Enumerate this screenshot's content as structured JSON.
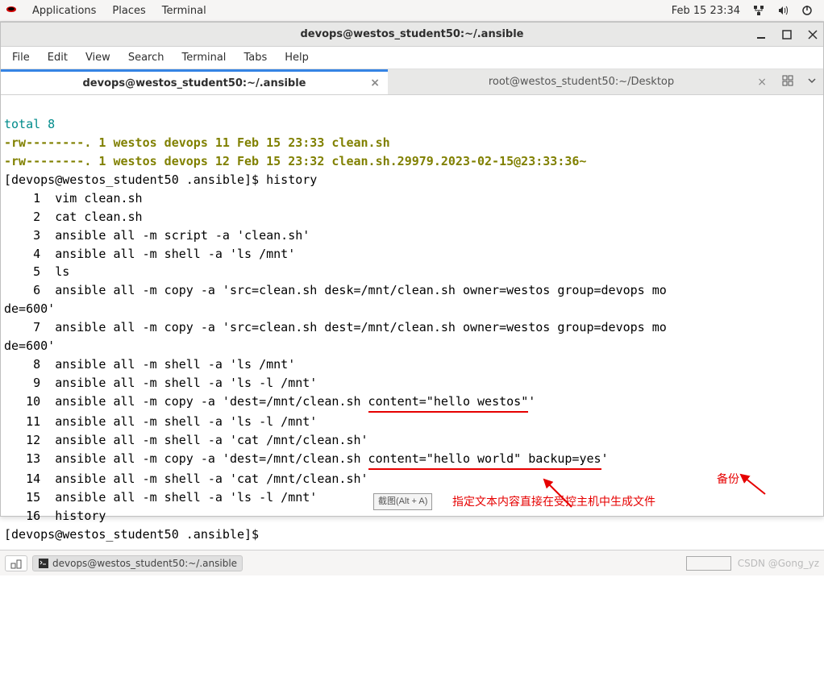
{
  "top_panel": {
    "applications": "Applications",
    "places": "Places",
    "terminal": "Terminal",
    "clock": "Feb 15  23:34"
  },
  "window": {
    "title": "devops@westos_student50:~/.ansible"
  },
  "menubar": {
    "file": "File",
    "edit": "Edit",
    "view": "View",
    "search": "Search",
    "terminal": "Terminal",
    "tabs": "Tabs",
    "help": "Help"
  },
  "tabs": {
    "active": "devops@westos_student50:~/.ansible",
    "inactive": "root@westos_student50:~/Desktop"
  },
  "terminal": {
    "l1": "total 8",
    "l2": "-rw--------. 1 westos devops 11 Feb 15 23:33 clean.sh",
    "l3": "-rw--------. 1 westos devops 12 Feb 15 23:32 clean.sh.29979.2023-02-15@23:33:36~",
    "prompt1_a": "[devops@westos_student50 .ansible]$ ",
    "prompt1_b": "history",
    "h1": "    1  vim clean.sh",
    "h2": "    2  cat clean.sh",
    "h3": "    3  ansible all -m script -a 'clean.sh'",
    "h4": "    4  ansible all -m shell -a 'ls /mnt'",
    "h5": "    5  ls",
    "h6a": "    6  ansible all -m copy -a 'src=clean.sh desk=/mnt/clean.sh owner=westos group=devops mo",
    "h6b": "de=600'",
    "h7a": "    7  ansible all -m copy -a 'src=clean.sh dest=/mnt/clean.sh owner=westos group=devops mo",
    "h7b": "de=600'",
    "h8": "    8  ansible all -m shell -a 'ls /mnt'",
    "h9": "    9  ansible all -m shell -a 'ls -l /mnt'",
    "h10a": "   10  ansible all -m copy -a 'dest=/mnt/clean.sh ",
    "h10b": "content=\"hello westos\"",
    "h10c": "'",
    "h11": "   11  ansible all -m shell -a 'ls -l /mnt'",
    "h12": "   12  ansible all -m shell -a 'cat /mnt/clean.sh'",
    "h13a": "   13  ansible all -m copy -a 'dest=/mnt/clean.sh ",
    "h13b": "content=\"hello world\" backup=yes",
    "h13c": "'",
    "h14": "   14  ansible all -m shell -a 'cat /mnt/clean.sh'",
    "h15": "   15  ansible all -m shell -a 'ls -l /mnt'",
    "h16": "   16  history",
    "prompt2": "[devops@westos_student50 .ansible]$ "
  },
  "annotations": {
    "badge": "截图(Alt + A)",
    "text1": "指定文本内容直接在受控主机中生成文件",
    "text2": "备份"
  },
  "taskbar": {
    "task": "devops@westos_student50:~/.ansible",
    "watermark": "CSDN @Gong_yz"
  }
}
